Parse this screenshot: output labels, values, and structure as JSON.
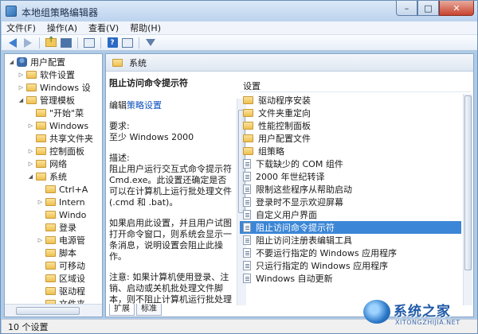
{
  "window": {
    "title": "本地组策略编辑器"
  },
  "menu": [
    "文件(F)",
    "操作(A)",
    "查看(V)",
    "帮助(H)"
  ],
  "tree": {
    "items": [
      {
        "label": "用户配置",
        "level": 0,
        "expand": "◢",
        "icon": "user"
      },
      {
        "label": "软件设置",
        "level": 1,
        "expand": "▷",
        "icon": "folder"
      },
      {
        "label": "Windows 设",
        "level": 1,
        "expand": "▷",
        "icon": "folder"
      },
      {
        "label": "管理模板",
        "level": 1,
        "expand": "◢",
        "icon": "folder"
      },
      {
        "label": "\"开始\"菜",
        "level": 2,
        "expand": "",
        "icon": "folder"
      },
      {
        "label": "Windows",
        "level": 2,
        "expand": "▷",
        "icon": "folder"
      },
      {
        "label": "共享文件夹",
        "level": 2,
        "expand": "",
        "icon": "folder"
      },
      {
        "label": "控制面板",
        "level": 2,
        "expand": "▷",
        "icon": "folder"
      },
      {
        "label": "网络",
        "level": 2,
        "expand": "▷",
        "icon": "folder"
      },
      {
        "label": "系统",
        "level": 2,
        "expand": "◢",
        "icon": "folder"
      },
      {
        "label": "Ctrl+A",
        "level": 3,
        "expand": "",
        "icon": "folder"
      },
      {
        "label": "Intern",
        "level": 3,
        "expand": "▷",
        "icon": "folder"
      },
      {
        "label": "Windo",
        "level": 3,
        "expand": "",
        "icon": "folder"
      },
      {
        "label": "登录",
        "level": 3,
        "expand": "",
        "icon": "folder"
      },
      {
        "label": "电源管",
        "level": 3,
        "expand": "▷",
        "icon": "folder"
      },
      {
        "label": "脚本",
        "level": 3,
        "expand": "",
        "icon": "folder"
      },
      {
        "label": "可移动",
        "level": 3,
        "expand": "",
        "icon": "folder"
      },
      {
        "label": "区域设",
        "level": 3,
        "expand": "",
        "icon": "folder"
      },
      {
        "label": "驱动程",
        "level": 3,
        "expand": "",
        "icon": "folder"
      },
      {
        "label": "文件夹",
        "level": 3,
        "expand": "",
        "icon": "folder"
      }
    ]
  },
  "right": {
    "header": "系统",
    "description": {
      "title": "阻止访问命令提示符",
      "edit_prefix": "编辑",
      "edit_link": "策略设置",
      "req_label": "要求:",
      "req_value": "至少 Windows 2000",
      "desc_label": "描述:",
      "desc_text": "阻止用户运行交互式命令提示符 Cmd.exe。此设置还确定是否可以在计算机上运行批处理文件(.cmd 和 .bat)。",
      "para2": "如果启用此设置，并且用户试图打开命令窗口，则系统会显示一条消息，说明设置会阻止此操作。",
      "para3": "注意: 如果计算机使用登录、注销、启动或关机批处理文件脚本，则不阻止计算机运行批处理文件，也不阻止使用远程桌面服务的用户"
    },
    "list_header": "设置",
    "list": [
      {
        "label": "驱动程序安装",
        "type": "folder"
      },
      {
        "label": "文件夹重定向",
        "type": "folder"
      },
      {
        "label": "性能控制面板",
        "type": "folder"
      },
      {
        "label": "用户配置文件",
        "type": "folder"
      },
      {
        "label": "组策略",
        "type": "folder"
      },
      {
        "label": "下载缺少的 COM 组件",
        "type": "policy"
      },
      {
        "label": "2000 年世纪转译",
        "type": "policy"
      },
      {
        "label": "限制这些程序从帮助启动",
        "type": "policy"
      },
      {
        "label": "登录时不显示欢迎屏幕",
        "type": "policy"
      },
      {
        "label": "自定义用户界面",
        "type": "policy"
      },
      {
        "label": "阻止访问命令提示符",
        "type": "policy",
        "selected": true
      },
      {
        "label": "阻止访问注册表编辑工具",
        "type": "policy"
      },
      {
        "label": "不要运行指定的 Windows 应用程序",
        "type": "policy"
      },
      {
        "label": "只运行指定的 Windows 应用程序",
        "type": "policy"
      },
      {
        "label": "Windows 自动更新",
        "type": "policy"
      }
    ],
    "tabs": [
      "扩展",
      "标准"
    ]
  },
  "status": {
    "text": "10 个设置"
  },
  "watermark": {
    "text": "系统之家",
    "sub": "XITONGZHIJIA.NET"
  }
}
